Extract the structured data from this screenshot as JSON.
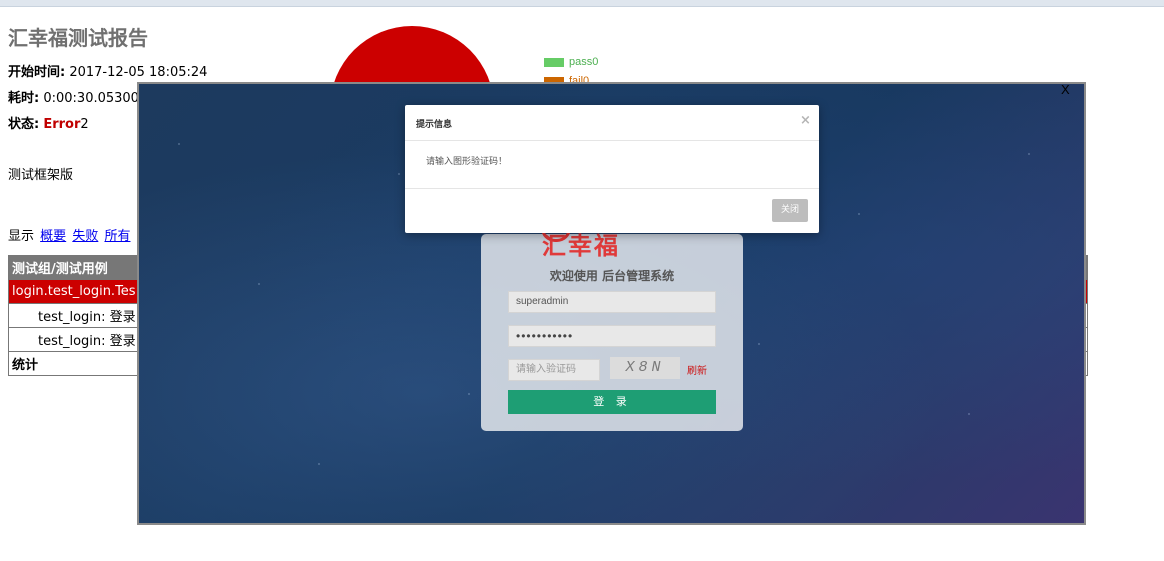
{
  "report": {
    "title": "汇幸福测试报告",
    "start_time_label": "开始时间:",
    "start_time_value": "2017-12-05 18:05:24",
    "duration_label": "耗时:",
    "duration_value": "0:00:30.05300",
    "status_label": "状态:",
    "status_error": "Error",
    "status_error_count": "2",
    "description": "测试框架版",
    "show_label": "显示",
    "show_links": [
      "概要",
      "失败",
      "所有"
    ]
  },
  "chart_legend": [
    {
      "label": "pass0",
      "color": "#66cc66",
      "text_color": "#4caf50"
    },
    {
      "label": "fail0",
      "color": "#cc6600",
      "text_color": "#cc6600"
    }
  ],
  "pie_color": "#cc0000",
  "table": {
    "header": "测试组/测试用例",
    "group_row": "login.test_login.Tes",
    "case_rows": [
      "test_login: 登录",
      "test_login: 登录"
    ],
    "total_row": "统计"
  },
  "overlay": {
    "close_label": "X",
    "login": {
      "logo_text": "汇幸福",
      "welcome": "欢迎使用 后台管理系统",
      "username_value": "superadmin",
      "password_value": "•••••••••••",
      "captcha_placeholder": "请输入验证码",
      "captcha_image_text": "X8N",
      "refresh_label": "刷新",
      "login_button": "登 录"
    },
    "modal": {
      "title": "提示信息",
      "close_x": "×",
      "message": "请输入图形验证码！",
      "close_button": "关闭"
    }
  }
}
